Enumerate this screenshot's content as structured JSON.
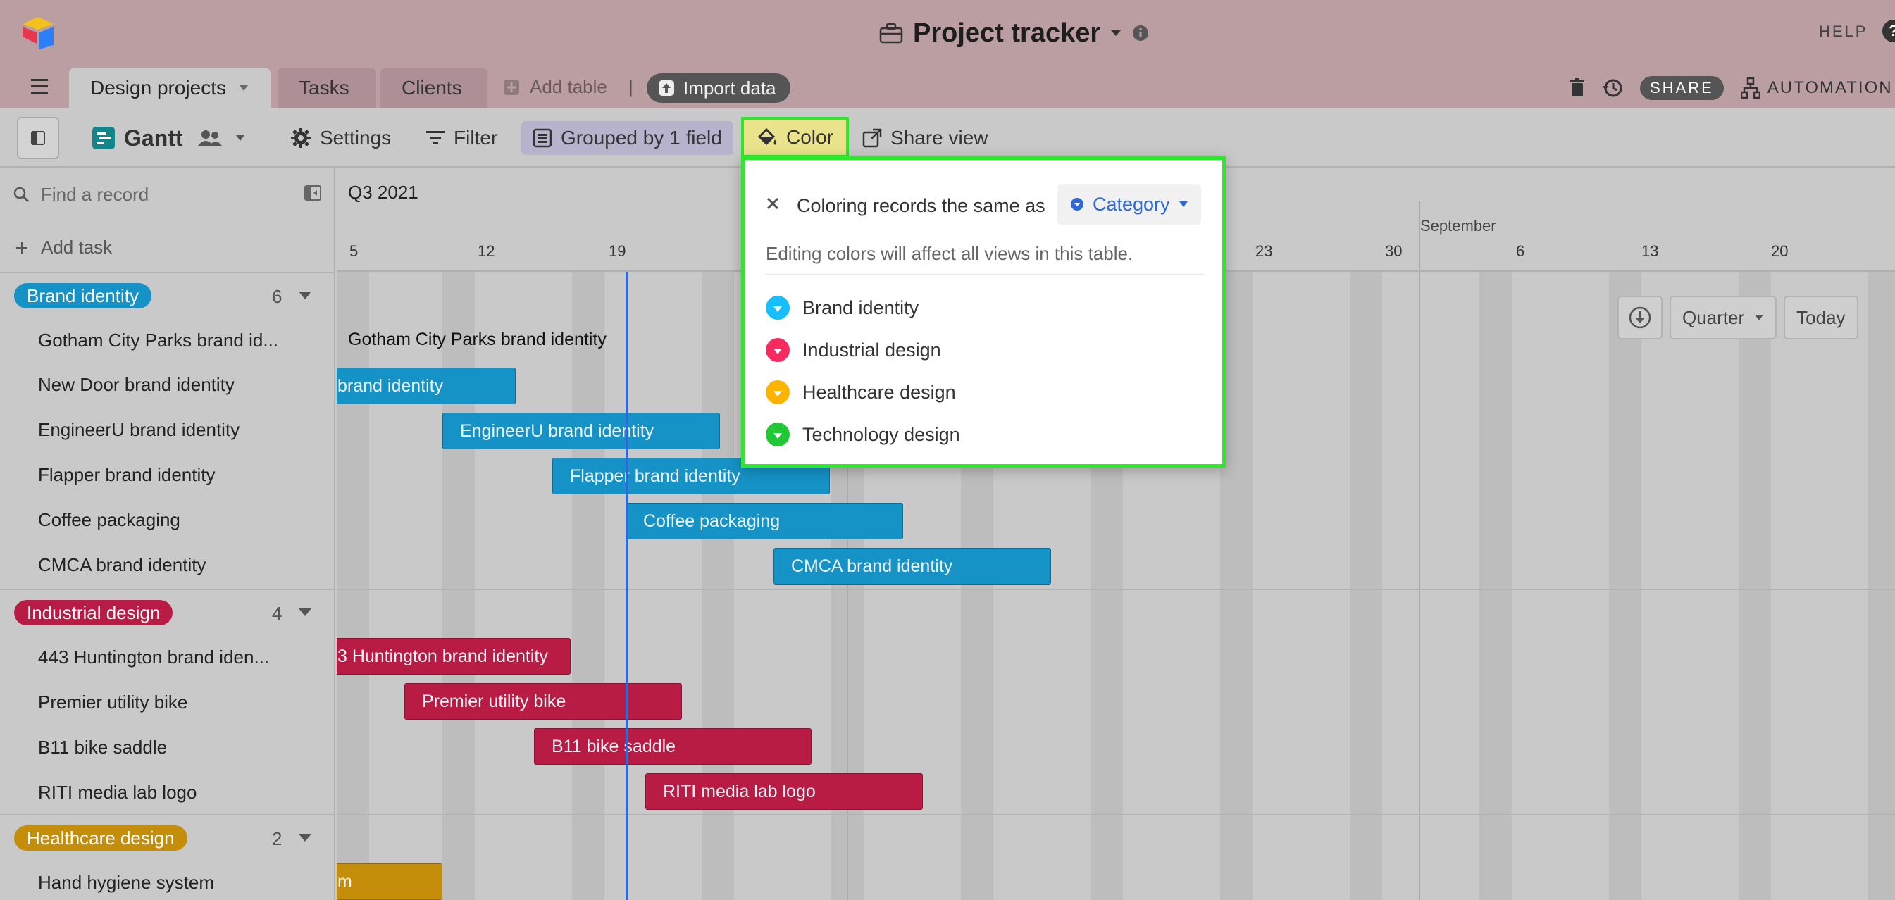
{
  "topbar": {
    "base_title": "Project tracker",
    "help_label": "HELP",
    "help_glyph": "?",
    "tabs": [
      {
        "label": "Design projects"
      },
      {
        "label": "Tasks"
      },
      {
        "label": "Clients"
      }
    ],
    "add_table_label": "Add table",
    "separator": "|",
    "import_label": "Import data",
    "share_label": "SHARE",
    "automation_label": "AUTOMATION"
  },
  "viewbar": {
    "view_name": "Gantt",
    "settings_label": "Settings",
    "filter_label": "Filter",
    "group_label": "Grouped by 1 field",
    "color_label": "Color",
    "share_view_label": "Share view"
  },
  "leftpanel": {
    "search_placeholder": "Find a record",
    "add_task_label": "Add task",
    "groups": [
      {
        "name": "Brand identity",
        "count": "6",
        "color": "#1592c6",
        "records": [
          "Gotham City Parks brand id...",
          "New Door brand identity",
          "EngineerU brand identity",
          "Flapper brand identity",
          "Coffee packaging",
          "CMCA brand identity"
        ]
      },
      {
        "name": "Industrial design",
        "count": "4",
        "color": "#b81c45",
        "records": [
          "443 Huntington brand iden...",
          "Premier utility bike",
          "B11 bike saddle",
          "RITI media lab logo"
        ]
      },
      {
        "name": "Healthcare design",
        "count": "2",
        "color": "#c48e0a",
        "records": [
          "Hand hygiene system"
        ]
      }
    ]
  },
  "timeline": {
    "quarter_label": "Q3 2021",
    "month_label": "September",
    "days": [
      "5",
      "12",
      "19",
      "23",
      "30",
      "6",
      "13",
      "20"
    ],
    "floating_label": "Gotham City Parks brand identity",
    "bars": [
      {
        "text": "brand identity"
      },
      {
        "text": "EngineerU brand identity"
      },
      {
        "text": "Flapper brand identity"
      },
      {
        "text": "Coffee packaging"
      },
      {
        "text": "CMCA brand identity"
      },
      {
        "text": "3 Huntington brand identity"
      },
      {
        "text": "Premier utility bike"
      },
      {
        "text": "B11 bike saddle"
      },
      {
        "text": "RITI media lab logo"
      },
      {
        "text": "m"
      }
    ],
    "controls": {
      "scale_label": "Quarter",
      "today_label": "Today"
    }
  },
  "color_popover": {
    "coloring_label": "Coloring records the same as",
    "field_label": "Category",
    "note": "Editing colors will affect all views in this table.",
    "options": [
      {
        "label": "Brand identity",
        "color": "#18bfff"
      },
      {
        "label": "Industrial design",
        "color": "#f82b60"
      },
      {
        "label": "Healthcare design",
        "color": "#fcb400"
      },
      {
        "label": "Technology design",
        "color": "#20c933"
      }
    ]
  }
}
